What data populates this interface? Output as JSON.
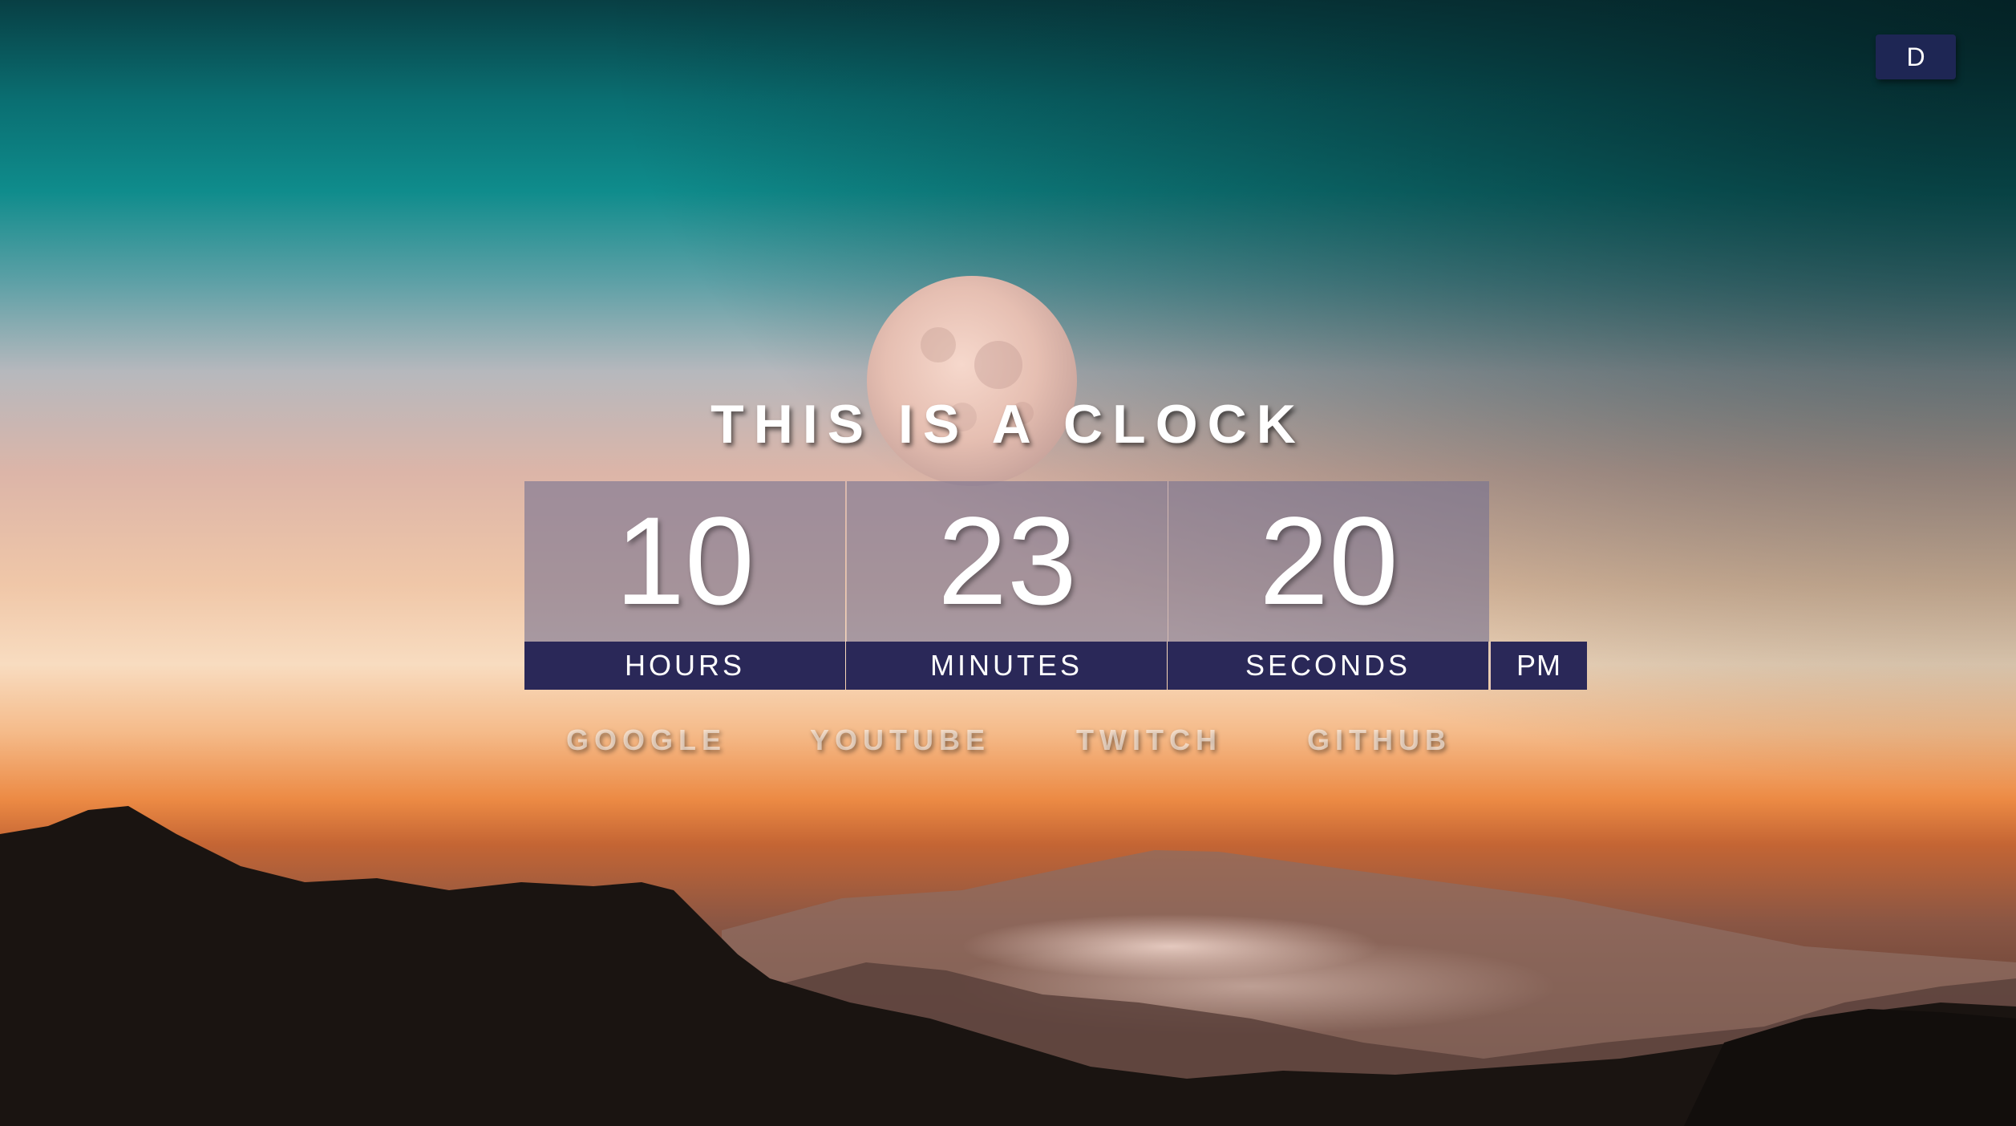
{
  "theme_button": {
    "label": "D"
  },
  "title": "THIS IS A CLOCK",
  "clock": {
    "hours": "10",
    "minutes": "23",
    "seconds": "20",
    "hours_label": "HOURS",
    "minutes_label": "MINUTES",
    "seconds_label": "SECONDS",
    "period": "PM"
  },
  "links": [
    {
      "label": "GOOGLE"
    },
    {
      "label": "YOUTUBE"
    },
    {
      "label": "TWITCH"
    },
    {
      "label": "GITHUB"
    }
  ],
  "colors": {
    "sky_top": "#0b4a4d",
    "sky_teal": "#0e8a8a",
    "horizon_glow": "#f6d2b0",
    "horizon_orange": "#e07a38",
    "mountain_dark": "#17120f",
    "label_bar": "#2a2858",
    "button_bg": "#1e2654"
  }
}
